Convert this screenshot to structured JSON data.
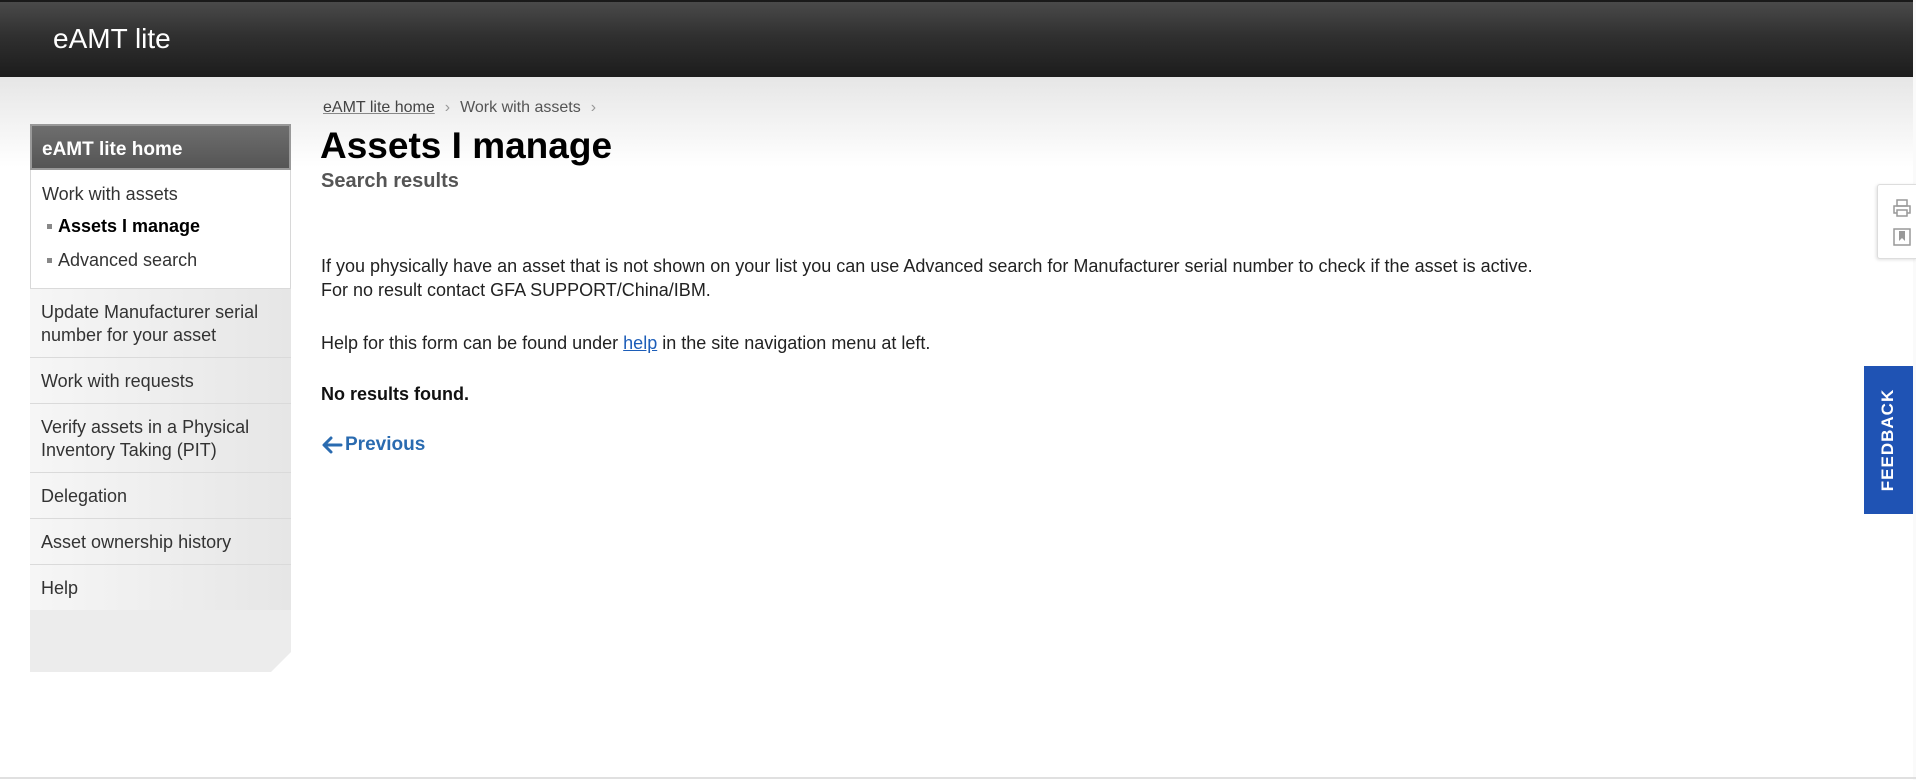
{
  "header": {
    "site_title": "eAMT lite"
  },
  "breadcrumb": [
    "eAMT lite home",
    "Work with assets"
  ],
  "page": {
    "title": "Assets I manage",
    "subtitle": "Search results",
    "intro_line1": "If you physically have an asset that is not shown on your list you can use Advanced search for Manufacturer serial number to check if the asset is active.",
    "intro_line2": "For no result contact GFA SUPPORT/China/IBM.",
    "help_prefix": "Help for this form can be found under ",
    "help_link": "help",
    "help_suffix": " in the site navigation menu at left.",
    "no_results": "No results found.",
    "previous": "Previous"
  },
  "sidebar": {
    "home": "eAMT lite home",
    "group_title": "Work with assets",
    "sub_items": [
      "Assets I manage",
      "Advanced search"
    ],
    "items": [
      "Update Manufacturer serial number for your asset",
      "Work with requests",
      "Verify assets in a Physical Inventory Taking (PIT)",
      "Delegation",
      "Asset ownership history",
      "Help"
    ]
  },
  "feedback": {
    "label": "FEEDBACK"
  },
  "page_tools": {
    "icons": [
      "print-icon",
      "bookmark-icon"
    ]
  },
  "colors": {
    "masthead": "#2b2b2b",
    "link_blue": "#1c5db8",
    "feedback_blue": "#1f53b4"
  }
}
